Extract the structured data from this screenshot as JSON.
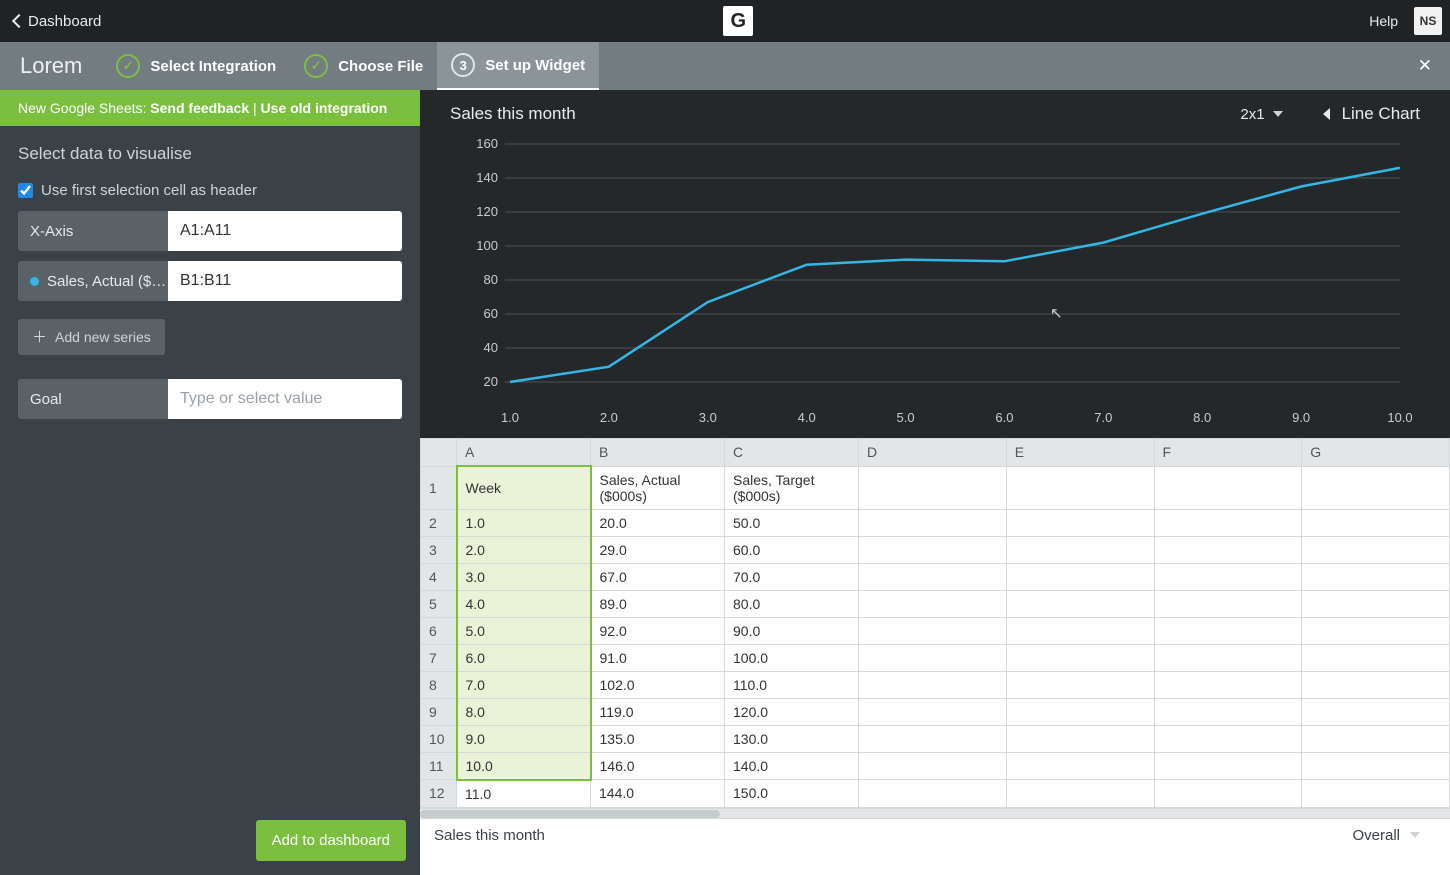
{
  "topbar": {
    "back_label": "Dashboard",
    "logo_letter": "G",
    "help_label": "Help",
    "user_initials": "NS"
  },
  "steps": {
    "brand": "Lorem",
    "step1_label": "Select Integration",
    "step2_label": "Choose File",
    "step3_number": "3",
    "step3_label": "Set up Widget"
  },
  "sidebar": {
    "notice_prefix": "New Google Sheets: ",
    "notice_feedback": "Send feedback",
    "notice_sep": " | ",
    "notice_old": "Use old integration",
    "heading": "Select data to visualise",
    "use_first_label": "Use first selection cell as header",
    "xaxis_label": "X-Axis",
    "xaxis_value": "A1:A11",
    "series1_short": "Sales, Actual ($…",
    "series1_value": "B1:B11",
    "add_series_label": "Add new series",
    "goal_label": "Goal",
    "goal_placeholder": "Type or select value",
    "add_dashboard_label": "Add to dashboard"
  },
  "chart": {
    "title": "Sales this month",
    "size_label": "2x1",
    "type_label": "Line Chart"
  },
  "chart_data": {
    "type": "line",
    "title": "Sales this month",
    "xlabel": "",
    "ylabel": "",
    "y_ticks": [
      20,
      40,
      60,
      80,
      100,
      120,
      140,
      160
    ],
    "x_ticks": [
      "1.0",
      "2.0",
      "3.0",
      "4.0",
      "5.0",
      "6.0",
      "7.0",
      "8.0",
      "9.0",
      "10.0"
    ],
    "series": [
      {
        "name": "Sales, Actual ($000s)",
        "color": "#35b6e6",
        "x": [
          1,
          2,
          3,
          4,
          5,
          6,
          7,
          8,
          9,
          10
        ],
        "y": [
          20,
          29,
          67,
          89,
          92,
          91,
          102,
          119,
          135,
          146
        ]
      }
    ],
    "ylim": [
      10,
      160
    ],
    "xlim": [
      1,
      10
    ]
  },
  "sheet": {
    "columns": [
      "A",
      "B",
      "C",
      "D",
      "E",
      "F",
      "G"
    ],
    "rows": [
      {
        "n": "1",
        "cells": [
          "Week",
          "Sales, Actual ($000s)",
          "Sales, Target ($000s)",
          "",
          "",
          "",
          ""
        ]
      },
      {
        "n": "2",
        "cells": [
          "1.0",
          "20.0",
          "50.0",
          "",
          "",
          "",
          ""
        ]
      },
      {
        "n": "3",
        "cells": [
          "2.0",
          "29.0",
          "60.0",
          "",
          "",
          "",
          ""
        ]
      },
      {
        "n": "4",
        "cells": [
          "3.0",
          "67.0",
          "70.0",
          "",
          "",
          "",
          ""
        ]
      },
      {
        "n": "5",
        "cells": [
          "4.0",
          "89.0",
          "80.0",
          "",
          "",
          "",
          ""
        ]
      },
      {
        "n": "6",
        "cells": [
          "5.0",
          "92.0",
          "90.0",
          "",
          "",
          "",
          ""
        ]
      },
      {
        "n": "7",
        "cells": [
          "6.0",
          "91.0",
          "100.0",
          "",
          "",
          "",
          ""
        ]
      },
      {
        "n": "8",
        "cells": [
          "7.0",
          "102.0",
          "110.0",
          "",
          "",
          "",
          ""
        ]
      },
      {
        "n": "9",
        "cells": [
          "8.0",
          "119.0",
          "120.0",
          "",
          "",
          "",
          ""
        ]
      },
      {
        "n": "10",
        "cells": [
          "9.0",
          "135.0",
          "130.0",
          "",
          "",
          "",
          ""
        ]
      },
      {
        "n": "11",
        "cells": [
          "10.0",
          "146.0",
          "140.0",
          "",
          "",
          "",
          ""
        ]
      },
      {
        "n": "12",
        "cells": [
          "11.0",
          "144.0",
          "150.0",
          "",
          "",
          "",
          ""
        ]
      }
    ],
    "bottom_tab": "Sales this month",
    "bottom_right": "Overall"
  }
}
